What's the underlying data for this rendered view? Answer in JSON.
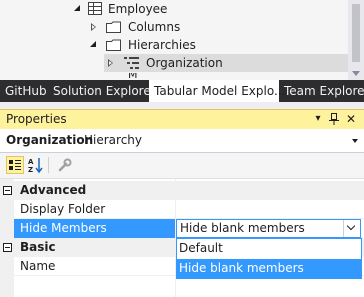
{
  "tree": {
    "items": [
      {
        "label": "Employee",
        "icon": "table-icon"
      },
      {
        "label": "Columns",
        "icon": "folder-icon"
      },
      {
        "label": "Hierarchies",
        "icon": "folder-icon"
      },
      {
        "label": "Organization",
        "icon": "hierarchy-icon"
      }
    ]
  },
  "tabs": [
    {
      "label": "GitHub"
    },
    {
      "label": "Solution Explorer"
    },
    {
      "label": "Tabular Model Explo..."
    },
    {
      "label": "Team Explorer"
    }
  ],
  "properties": {
    "title": "Properties",
    "object_name": "Organization",
    "object_type": "Hierarchy",
    "categories": [
      {
        "name": "Advanced",
        "rows": [
          {
            "label": "Display Folder",
            "value": ""
          },
          {
            "label": "Hide Members",
            "value": "Hide blank members"
          }
        ]
      },
      {
        "name": "Basic",
        "rows": [
          {
            "label": "Name",
            "value": ""
          }
        ]
      }
    ],
    "dropdown_options": [
      "Default",
      "Hide blank members"
    ],
    "highlighted_option": "Hide blank members"
  },
  "colors": {
    "accent": "#3399ff",
    "tab_strip": "#2d2d30",
    "header_yellow": "#fff29d"
  }
}
